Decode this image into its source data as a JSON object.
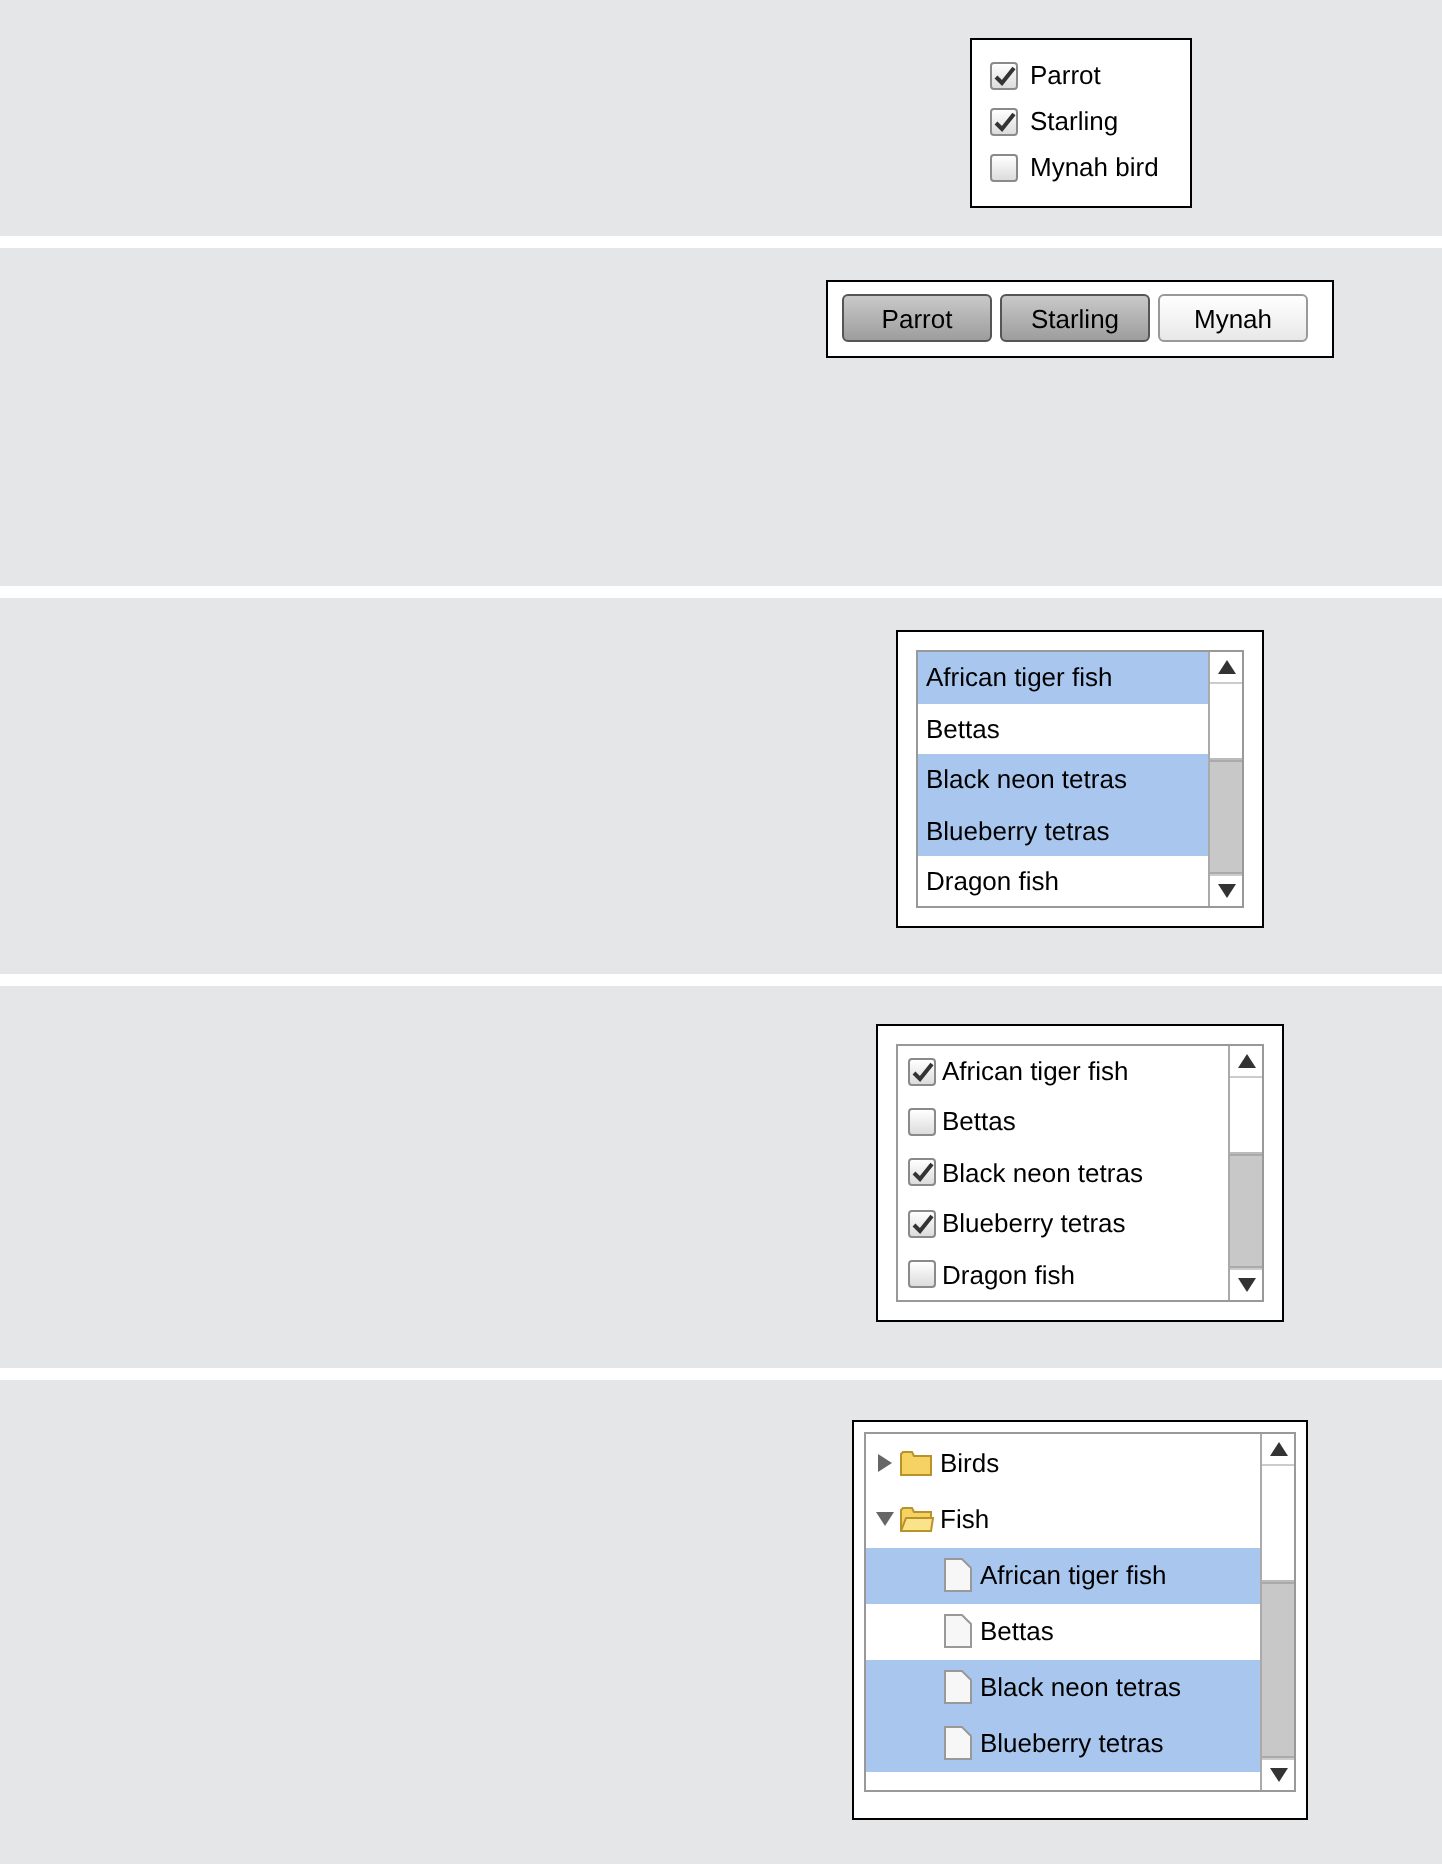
{
  "checkbox_group": [
    {
      "label": "Parrot",
      "checked": true
    },
    {
      "label": "Starling",
      "checked": true
    },
    {
      "label": "Mynah bird",
      "checked": false
    }
  ],
  "toggle_buttons": [
    {
      "label": "Parrot",
      "selected": true
    },
    {
      "label": "Starling",
      "selected": true
    },
    {
      "label": "Mynah",
      "selected": false
    }
  ],
  "list_box": [
    {
      "label": "African tiger fish",
      "selected": true
    },
    {
      "label": "Bettas",
      "selected": false
    },
    {
      "label": "Black neon tetras",
      "selected": true
    },
    {
      "label": "Blueberry tetras",
      "selected": true
    },
    {
      "label": "Dragon fish",
      "selected": false
    }
  ],
  "checkbox_list": [
    {
      "label": "African tiger fish",
      "checked": true
    },
    {
      "label": "Bettas",
      "checked": false
    },
    {
      "label": "Black neon tetras",
      "checked": true
    },
    {
      "label": "Blueberry tetras",
      "checked": true
    },
    {
      "label": "Dragon fish",
      "checked": false
    }
  ],
  "tree": [
    {
      "label": "Birds",
      "expanded": false
    },
    {
      "label": "Fish",
      "expanded": true,
      "children": [
        {
          "label": "African tiger fish",
          "selected": true
        },
        {
          "label": "Bettas",
          "selected": false
        },
        {
          "label": "Black neon tetras",
          "selected": true
        },
        {
          "label": "Blueberry tetras",
          "selected": true
        }
      ]
    }
  ]
}
